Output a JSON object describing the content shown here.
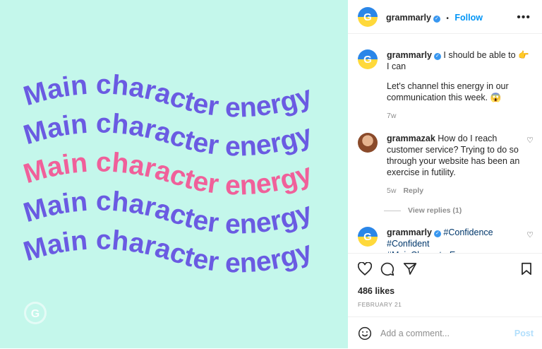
{
  "post": {
    "art_text": "Main character energy",
    "art_colors": {
      "background": "#c4f7eb",
      "primary": "#6a5be2",
      "highlight": "#f0609a"
    },
    "watermark_icon": "grammarly-logo-icon"
  },
  "header": {
    "username": "grammarly",
    "verified_icon": "verified-badge-icon",
    "separator": "•",
    "follow_label": "Follow",
    "more_label": "•••"
  },
  "comments": [
    {
      "username": "grammarly",
      "text": "I should be able to 👉 I can",
      "text2": "Let's channel this energy in our communication this week. 😱",
      "time": "7w"
    },
    {
      "username": "grammazak",
      "text": "How do I reach customer service? Trying to do so through your website has been an exercise in futility.",
      "time": "5w",
      "reply_label": "Reply",
      "view_replies_label": "View replies (1)"
    },
    {
      "username": "grammarly",
      "text": "#Confidence #Confident #MainCharacterEnergy #MainCharacter #Grammarly"
    }
  ],
  "likes": "486 likes",
  "date": "FEBRUARY 21",
  "add_comment": {
    "placeholder": "Add a comment...",
    "post_label": "Post"
  },
  "colors": {
    "link": "#0095f6",
    "verified": "#3897f0",
    "muted": "#8e8e8e"
  }
}
